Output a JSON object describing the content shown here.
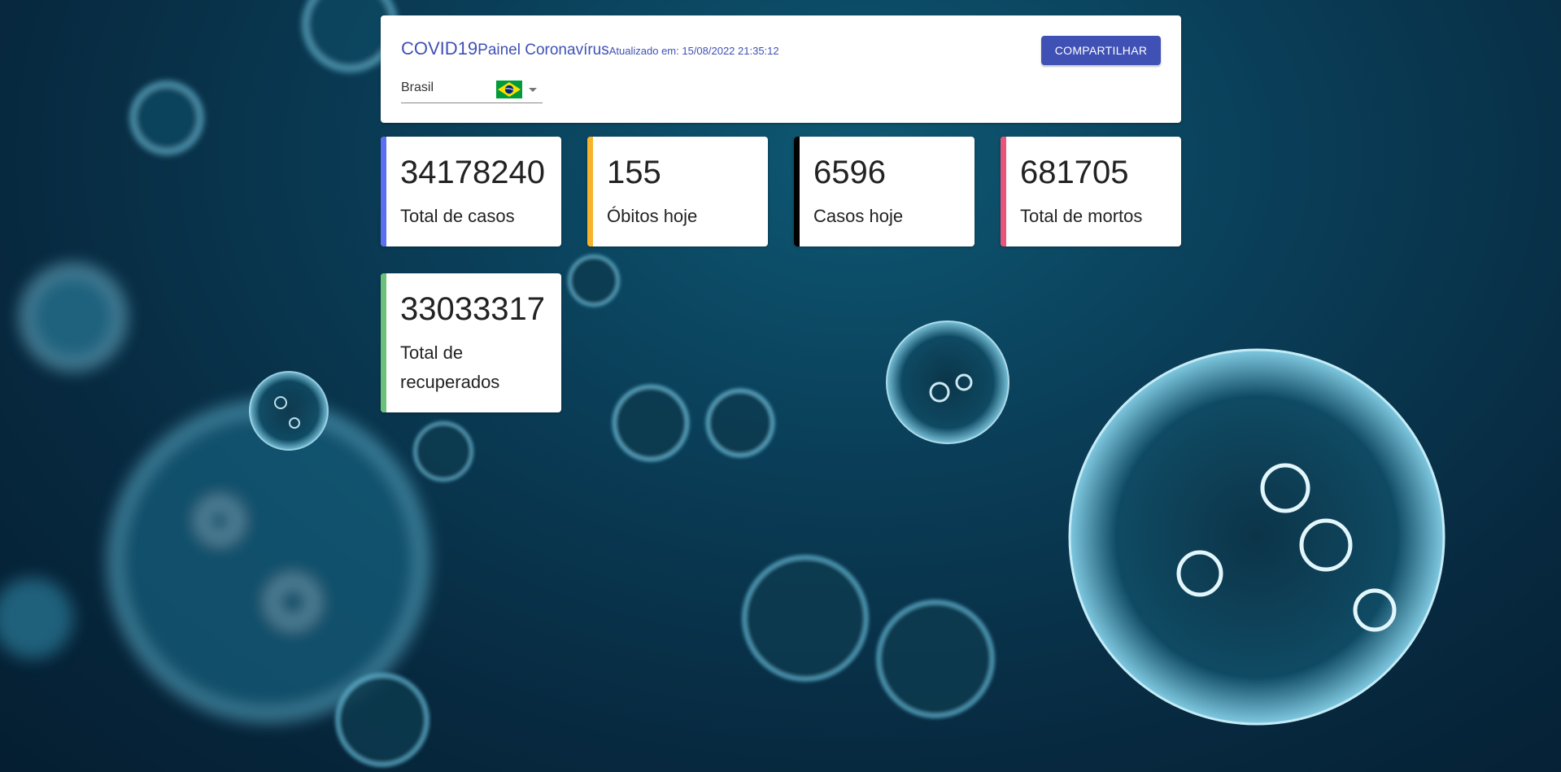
{
  "header": {
    "title": "COVID19",
    "subtitle": "Painel Coronavírus",
    "updated": "Atualizado em: 15/08/2022 21:35:12",
    "share_label": "COMPARTILHAR"
  },
  "country_select": {
    "value": "Brasil",
    "flag_icon": "brazil-flag-icon"
  },
  "stats": [
    {
      "value": "34178240",
      "label": "Total de casos",
      "color": "#5b6ff0"
    },
    {
      "value": "155",
      "label": "Óbitos hoje",
      "color": "#f7b32b"
    },
    {
      "value": "6596",
      "label": "Casos hoje",
      "color": "#000000"
    },
    {
      "value": "681705",
      "label": "Total de mortos",
      "color": "#e9557a"
    },
    {
      "value": "33033317",
      "label": "Total de recuperados",
      "color": "#6cc17a"
    }
  ],
  "colors": {
    "primary": "#3f51b5",
    "background": "#0a3e58"
  }
}
